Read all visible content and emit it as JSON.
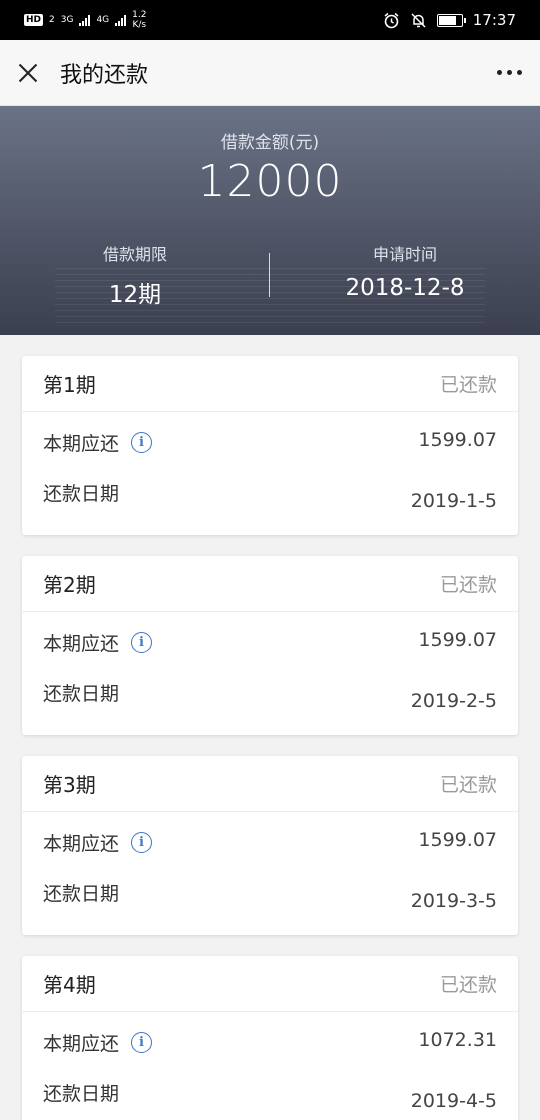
{
  "status_bar": {
    "hd": "HD",
    "sim": "2",
    "net1": "3G",
    "net2": "4G",
    "speed_value": "1.2",
    "speed_unit": "K/s",
    "time": "17:37"
  },
  "nav": {
    "title": "我的还款"
  },
  "summary": {
    "amount_label": "借款金额(元)",
    "amount": "12000",
    "term_label": "借款期限",
    "term": "12期",
    "date_label": "申请时间",
    "date": "2018-12-8"
  },
  "installments": [
    {
      "period": "第1期",
      "status": "已还款",
      "due_label": "本期应还",
      "due": "1599.07",
      "date_label": "还款日期",
      "date": "2019-1-5"
    },
    {
      "period": "第2期",
      "status": "已还款",
      "due_label": "本期应还",
      "due": "1599.07",
      "date_label": "还款日期",
      "date": "2019-2-5"
    },
    {
      "period": "第3期",
      "status": "已还款",
      "due_label": "本期应还",
      "due": "1599.07",
      "date_label": "还款日期",
      "date": "2019-3-5"
    },
    {
      "period": "第4期",
      "status": "已还款",
      "due_label": "本期应还",
      "due": "1072.31",
      "date_label": "还款日期",
      "date": "2019-4-5"
    }
  ],
  "colors": {
    "hero_top": "#6a7286",
    "hero_bottom": "#3b3f4e",
    "info_icon": "#3a78c9",
    "status_text": "#9a9a9a"
  },
  "icons": {
    "close": "close-icon",
    "more": "more-icon",
    "info": "info-icon",
    "alarm": "alarm-icon",
    "mute": "bell-off-icon",
    "battery": "battery-icon"
  },
  "battery_level": 0.8
}
